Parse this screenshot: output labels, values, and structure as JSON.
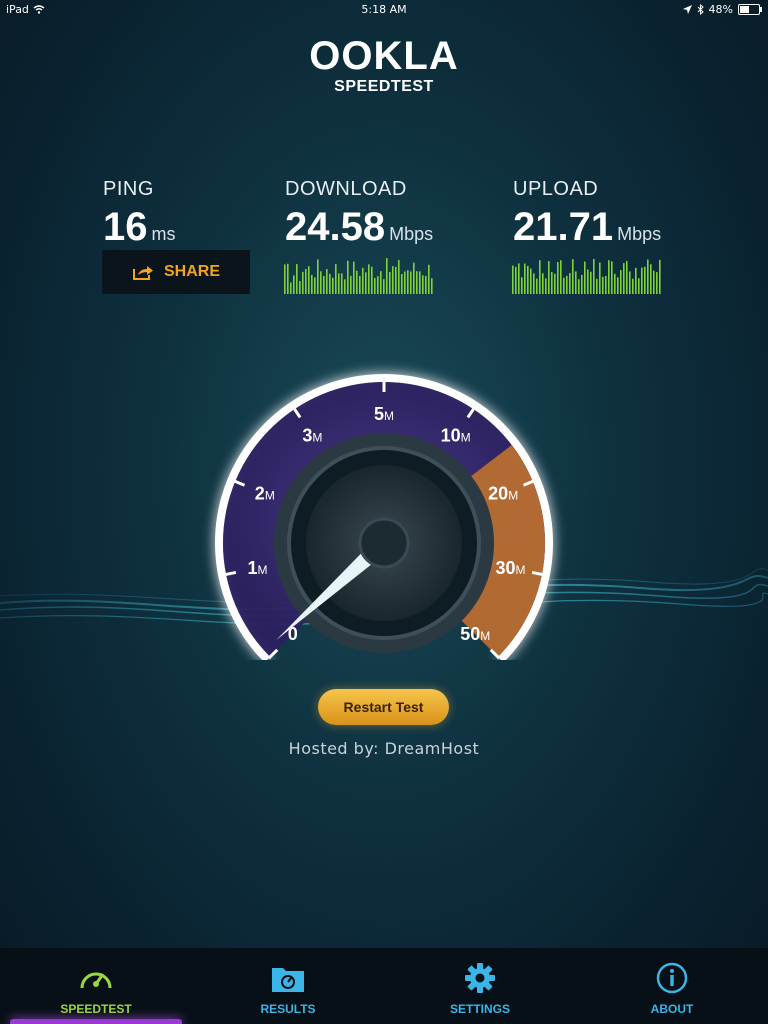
{
  "status_bar": {
    "device": "iPad",
    "time": "5:18 AM",
    "battery": "48%",
    "battery_level": 0.48
  },
  "logo": {
    "brand": "OOKLA",
    "product": "SPEEDTEST"
  },
  "metrics": {
    "ping": {
      "label": "PING",
      "value": "16",
      "unit": "ms"
    },
    "download": {
      "label": "DOWNLOAD",
      "value": "24.58",
      "unit": "Mbps"
    },
    "upload": {
      "label": "UPLOAD",
      "value": "21.71",
      "unit": "Mbps"
    }
  },
  "share": {
    "label": "SHARE",
    "icon": "share-icon"
  },
  "gauge": {
    "ticks": [
      "0",
      "1",
      "2",
      "3",
      "5",
      "10",
      "20",
      "30",
      "50"
    ],
    "tick_unit": "M",
    "needle_value": "0.3"
  },
  "restart_label": "Restart Test",
  "hosted_by": "Hosted by: DreamHost",
  "tabs": [
    {
      "label": "SPEEDTEST",
      "icon": "speedometer-icon",
      "active": true
    },
    {
      "label": "RESULTS",
      "icon": "results-folder-icon",
      "active": false
    },
    {
      "label": "SETTINGS",
      "icon": "gear-icon",
      "active": false
    },
    {
      "label": "ABOUT",
      "icon": "info-icon",
      "active": false
    }
  ],
  "colors": {
    "accent_green": "#9bd93c",
    "accent_blue": "#3bb4e6",
    "accent_orange": "#f2a51e",
    "active_purple": "#9b38d6"
  }
}
